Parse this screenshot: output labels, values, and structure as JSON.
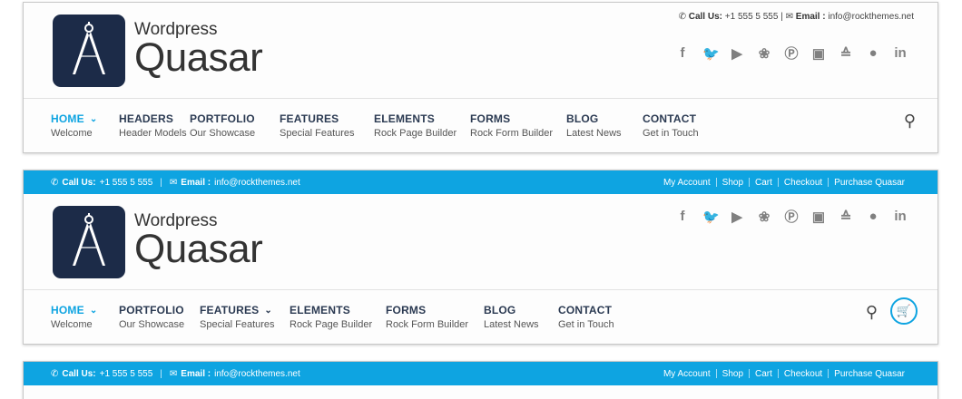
{
  "contact": {
    "call_label": "Call Us:",
    "phone": "+1 555 5 555",
    "email_label": "Email :",
    "email": "info@rockthemes.net"
  },
  "logo": {
    "small": "Wordpress",
    "big": "Quasar"
  },
  "account_links": [
    "My Account",
    "Shop",
    "Cart",
    "Checkout",
    "Purchase Quasar"
  ],
  "social": [
    "f",
    "t",
    "yt",
    "db",
    "p",
    "ig",
    "su",
    "fl",
    "in"
  ],
  "header1": {
    "nav": [
      {
        "title": "HOME",
        "sub": "Welcome",
        "dropdown": true,
        "active": true
      },
      {
        "title": "HEADERS",
        "sub": "Header Models"
      },
      {
        "title": "PORTFOLIO",
        "sub": "Our Showcase"
      },
      {
        "title": "FEATURES",
        "sub": "Special Features"
      },
      {
        "title": "ELEMENTS",
        "sub": "Rock Page Builder"
      },
      {
        "title": "FORMS",
        "sub": "Rock Form Builder"
      },
      {
        "title": "BLOG",
        "sub": "Latest News"
      },
      {
        "title": "CONTACT",
        "sub": "Get in Touch"
      }
    ]
  },
  "header2": {
    "nav": [
      {
        "title": "HOME",
        "sub": "Welcome",
        "dropdown": true,
        "active": true
      },
      {
        "title": "PORTFOLIO",
        "sub": "Our Showcase"
      },
      {
        "title": "FEATURES",
        "sub": "Special Features",
        "dropdown": true
      },
      {
        "title": "ELEMENTS",
        "sub": "Rock Page Builder"
      },
      {
        "title": "FORMS",
        "sub": "Rock Form Builder"
      },
      {
        "title": "BLOG",
        "sub": "Latest News"
      },
      {
        "title": "CONTACT",
        "sub": "Get in Touch"
      }
    ]
  },
  "icons": {
    "phone": "phone-icon",
    "email": "envelope-icon",
    "search": "search-icon",
    "cart": "cart-icon",
    "chevron": "chevron-down-icon"
  },
  "colors": {
    "accent": "#0ea4e1",
    "logo_bg": "#1c2b48",
    "nav_text": "#2b3a52",
    "social": "#808080"
  }
}
